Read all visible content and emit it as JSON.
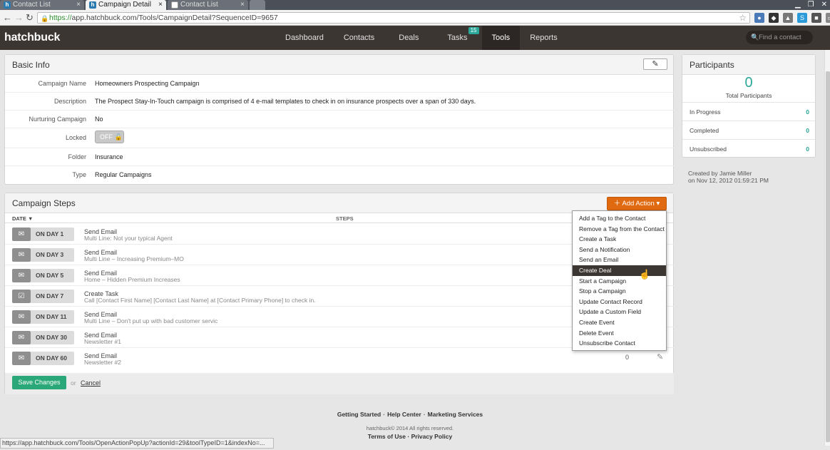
{
  "browser": {
    "tabs": [
      {
        "label": "Contact List",
        "favicon": "h"
      },
      {
        "label": "Campaign Detail",
        "favicon": "h"
      },
      {
        "label": "Contact List",
        "favicon": ""
      }
    ],
    "url_scheme": "https://",
    "url_rest": "app.hatchbuck.com/Tools/CampaignDetail?SequenceID=9657",
    "status_url": "https://app.hatchbuck.com/Tools/OpenActionPopUp?actionId=29&toolTypeID=1&indexNo=..."
  },
  "app": {
    "logo": "hatchbuck",
    "nav": [
      {
        "label": "Dashboard"
      },
      {
        "label": "Contacts"
      },
      {
        "label": "Deals"
      },
      {
        "label": "Tasks",
        "badge": "15"
      },
      {
        "label": "Tools"
      },
      {
        "label": "Reports"
      }
    ],
    "search_placeholder": "Find a contact"
  },
  "basic_info": {
    "title": "Basic Info",
    "rows": [
      {
        "label": "Campaign Name",
        "value": "Homeowners Prospecting Campaign"
      },
      {
        "label": "Description",
        "value": "The Prospect Stay-In-Touch campaign is comprised of 4 e-mail templates to check in on insurance prospects over a span of 330 days."
      },
      {
        "label": "Nurturing Campaign",
        "value": "No"
      },
      {
        "label": "Locked",
        "value": "OFF"
      },
      {
        "label": "Folder",
        "value": "Insurance"
      },
      {
        "label": "Type",
        "value": "Regular Campaigns"
      }
    ]
  },
  "campaign_steps": {
    "title": "Campaign Steps",
    "add_action_label": "Add Action",
    "col_date": "DATE",
    "col_steps": "STEPS",
    "steps": [
      {
        "day": "ON DAY  1",
        "type": "Send Email",
        "detail": "Multi Line: Not your typical Agent",
        "icon": "envelope-icon"
      },
      {
        "day": "ON DAY  3",
        "type": "Send Email",
        "detail": "Multi Line – Increasing Premium–MO",
        "icon": "envelope-icon"
      },
      {
        "day": "ON DAY  5",
        "type": "Send Email",
        "detail": "Home – Hidden Premium Increases",
        "icon": "envelope-icon"
      },
      {
        "day": "ON DAY  7",
        "type": "Create Task",
        "detail": "Call [Contact First Name] [Contact Last Name] at [Contact Primary Phone] to check in.",
        "icon": "checklist-icon"
      },
      {
        "day": "ON DAY  11",
        "type": "Send Email",
        "detail": "Multi Line – Don't put up with bad customer servic",
        "icon": "envelope-icon"
      },
      {
        "day": "ON DAY  30",
        "type": "Send Email",
        "detail": "Newsletter #1",
        "icon": "envelope-icon"
      },
      {
        "day": "ON DAY  60",
        "type": "Send Email",
        "detail": "Newsletter #2",
        "icon": "envelope-icon",
        "count": "0"
      }
    ],
    "save_label": "Save Changes",
    "or_label": "or",
    "cancel_label": "Cancel"
  },
  "action_menu": {
    "items": [
      "Add a Tag to the Contact",
      "Remove a Tag from the Contact",
      "Create a Task",
      "Send a Notification",
      "Send an Email",
      "Create Deal",
      "Start a Campaign",
      "Stop a Campaign",
      "Update Contact Record",
      "Update a Custom Field",
      "Create Event",
      "Delete Event",
      "Unsubscribe Contact"
    ],
    "hovered": "Create Deal"
  },
  "participants": {
    "title": "Participants",
    "total": "0",
    "total_label": "Total Participants",
    "rows": [
      {
        "label": "In Progress",
        "value": "0"
      },
      {
        "label": "Completed",
        "value": "0"
      },
      {
        "label": "Unsubscribed",
        "value": "0"
      }
    ],
    "created_by": "Created by Jamie Miller",
    "created_on": "on Nov 12, 2012 01:59:21 PM"
  },
  "footer": {
    "links": [
      "Getting Started",
      "Help Center",
      "Marketing Services"
    ],
    "copyright": "hatchbuck© 2014 All rights reserved.",
    "terms": "Terms of Use",
    "privacy": "Privacy Policy"
  },
  "colors": {
    "accent": "#2aa89a",
    "action": "#e06a10",
    "save": "#2aa87a",
    "header": "#3c3633"
  }
}
